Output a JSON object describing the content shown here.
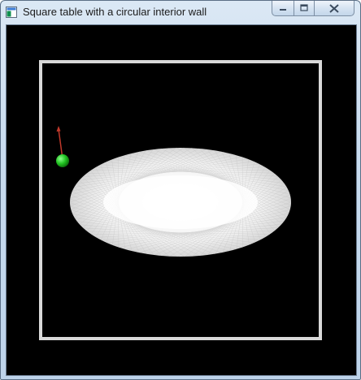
{
  "window": {
    "title": "Square table with a circular interior wall",
    "icons": {
      "app": "window-app-icon",
      "minimize": "minimize-icon",
      "maximize": "maximize-icon",
      "close": "close-icon"
    }
  },
  "scene": {
    "background_color": "#000000",
    "table_border_color": "#d9d9d9",
    "wall_color": "#ffffff",
    "ball_color": "#22c422",
    "velocity_arrow_color": "#c0392b"
  }
}
